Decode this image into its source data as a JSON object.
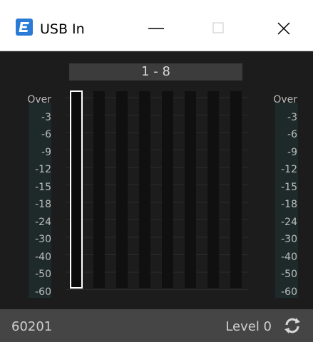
{
  "window": {
    "title": "USB In",
    "icon": "app-logo-icon",
    "controls": [
      "minimize-icon",
      "maximize-icon",
      "close-icon"
    ]
  },
  "meter_group": {
    "label": "1 - 8",
    "channel_count": 8,
    "selected_channel": 1,
    "scale_left": [
      "Over",
      "-3",
      "-6",
      "-9",
      "-12",
      "-15",
      "-18",
      "-24",
      "-30",
      "-40",
      "-50",
      "-60"
    ],
    "scale_right": [
      "Over",
      "-3",
      "-6",
      "-9",
      "-12",
      "-15",
      "-18",
      "-24",
      "-30",
      "-40",
      "-50",
      "-60"
    ]
  },
  "status": {
    "device_id": "60201",
    "level_label": "Level 0",
    "refresh_icon": "refresh-icon"
  },
  "colors": {
    "accent": "#2a7bd6",
    "meter_bg": "#101010",
    "selected_outline": "#ffffff"
  }
}
